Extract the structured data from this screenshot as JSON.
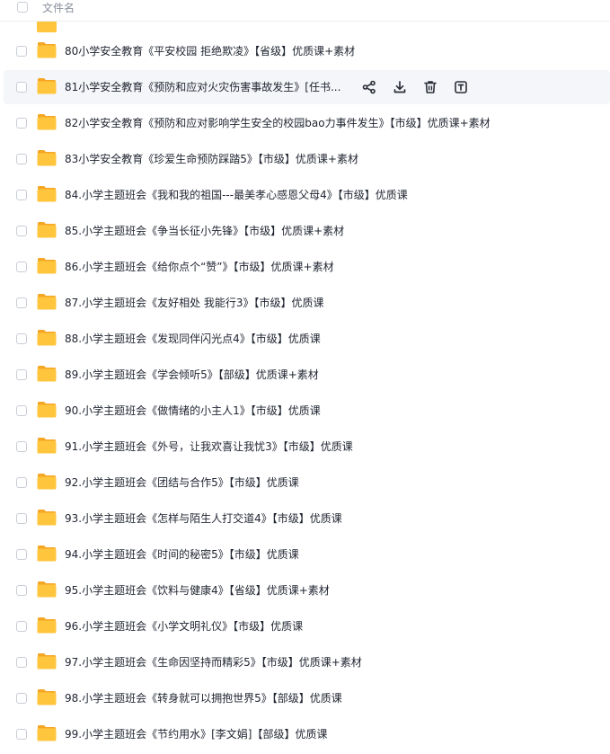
{
  "header": {
    "column_title": "文件名"
  },
  "rows": [
    "80小学安全教育《平安校园 拒绝欺凌》【省级】优质课+素材",
    "81小学安全教育《预防和应对火灾伤害事故发生》[任书...",
    "82小学安全教育《预防和应对影响学生安全的校园bao力事件发生》【市级】优质课+素材",
    "83小学安全教育《珍爱生命预防踩踏5》【市级】优质课+素材",
    "84.小学主题班会《我和我的祖国---最美孝心感恩父母4》【市级】优质课",
    "85.小学主题班会《争当长征小先锋》【市级】优质课+素材",
    "86.小学主题班会《给你点个“赞”》【市级】优质课+素材",
    "87.小学主题班会《友好相处 我能行3》【市级】优质课",
    "88.小学主题班会《发现同伴闪光点4》【市级】优质课",
    "89.小学主题班会《学会倾听5》【部级】优质课+素材",
    "90.小学主题班会《做情绪的小主人1》【市级】优质课",
    "91.小学主题班会《外号，让我欢喜让我忧3》【市级】优质课",
    "92.小学主题班会《团结与合作5》【市级】优质课",
    "93.小学主题班会《怎样与陌生人打交道4》【市级】优质课",
    "94.小学主题班会《时间的秘密5》【市级】优质课",
    "95.小学主题班会《饮料与健康4》【省级】优质课+素材",
    "96.小学主题班会《小学文明礼仪》【市级】优质课",
    "97.小学主题班会《生命因坚持而精彩5》【市级】优质课+素材",
    "98.小学主题班会《转身就可以拥抱世界5》【部级】优质课",
    "99.小学主题班会《节约用水》[李文娟]【部级】优质课"
  ],
  "hover_row_index": 1,
  "hover_actions": [
    "share-icon",
    "download-icon",
    "delete-icon",
    "more-icon"
  ],
  "colors": {
    "folder": "#FFC53D",
    "folder_back": "#F5A623",
    "hover_bg": "#F5F6F9"
  }
}
